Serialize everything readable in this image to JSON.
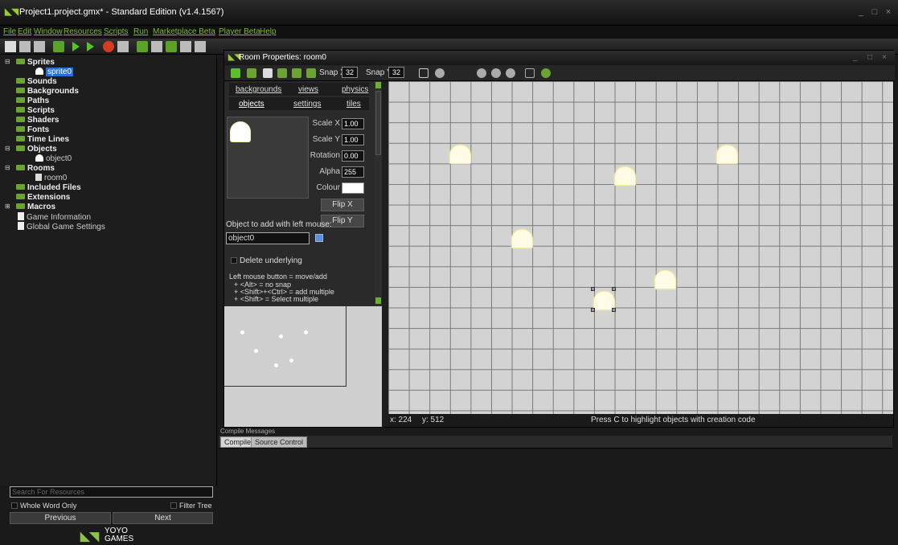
{
  "window": {
    "title": "Project1.project.gmx* - Standard Edition (v1.4.1567)",
    "controls": [
      "_",
      "□",
      "×"
    ]
  },
  "menu": [
    "File",
    "Edit",
    "Window",
    "Resources",
    "Scripts",
    "Run",
    "Marketplace Beta",
    "Player Beta",
    "Help"
  ],
  "tree": {
    "items": [
      {
        "label": "Sprites",
        "kind": "folder",
        "expanded": true
      },
      {
        "label": "sprite0",
        "kind": "sprite",
        "selected": true
      },
      {
        "label": "Sounds",
        "kind": "folder"
      },
      {
        "label": "Backgrounds",
        "kind": "folder"
      },
      {
        "label": "Paths",
        "kind": "folder"
      },
      {
        "label": "Scripts",
        "kind": "folder"
      },
      {
        "label": "Shaders",
        "kind": "folder"
      },
      {
        "label": "Fonts",
        "kind": "folder"
      },
      {
        "label": "Time Lines",
        "kind": "folder"
      },
      {
        "label": "Objects",
        "kind": "folder",
        "expanded": true
      },
      {
        "label": "object0",
        "kind": "object"
      },
      {
        "label": "Rooms",
        "kind": "folder",
        "expanded": true
      },
      {
        "label": "room0",
        "kind": "room"
      },
      {
        "label": "Included Files",
        "kind": "folder"
      },
      {
        "label": "Extensions",
        "kind": "folder"
      },
      {
        "label": "Macros",
        "kind": "folder"
      },
      {
        "label": "Game Information",
        "kind": "info"
      },
      {
        "label": "Global Game Settings",
        "kind": "info"
      }
    ],
    "search_placeholder": "Search For Resources",
    "whole_word": "Whole Word Only",
    "filter_tree": "Filter Tree",
    "prev_button": "Previous",
    "next_button": "Next"
  },
  "brand": {
    "logo_text": "YOYO",
    "logo_sub": "GAMES"
  },
  "room": {
    "title": "Room Properties: room0",
    "snap_x_label": "Snap X",
    "snap_x": "32",
    "snap_y_label": "Snap Y",
    "snap_y": "32",
    "tabs_top": [
      "backgrounds",
      "views",
      "physics"
    ],
    "tabs_bottom": [
      "objects",
      "settings",
      "tiles"
    ],
    "props": {
      "scale_x_label": "Scale X",
      "scale_x": "1.00",
      "scale_y_label": "Scale Y",
      "scale_y": "1.00",
      "rotation_label": "Rotation",
      "rotation": "0.00",
      "alpha_label": "Alpha",
      "alpha": "255",
      "colour_label": "Colour",
      "colour": "#ffffff"
    },
    "flip_x": "Flip X",
    "flip_y": "Flip Y",
    "object_label": "Object to add with left mouse:",
    "object_value": "object0",
    "delete_underlying": "Delete underlying",
    "help_lines": [
      "Left mouse button = move/add",
      "+ <Alt> = no snap",
      "+ <Shift>+<Ctrl> = add multiple",
      "+ <Shift> = Select multiple"
    ],
    "status_x": "x: 224",
    "status_y": "y: 512",
    "status_hint": "Press C to highlight objects with creation code"
  },
  "compile": {
    "title": "Compile Messages",
    "tabs": [
      "Compile",
      "Source Control"
    ]
  },
  "colors": {
    "accent": "#7cbb2a",
    "selection": "#2a6fd6",
    "grid_bg": "#d3d3d3"
  }
}
